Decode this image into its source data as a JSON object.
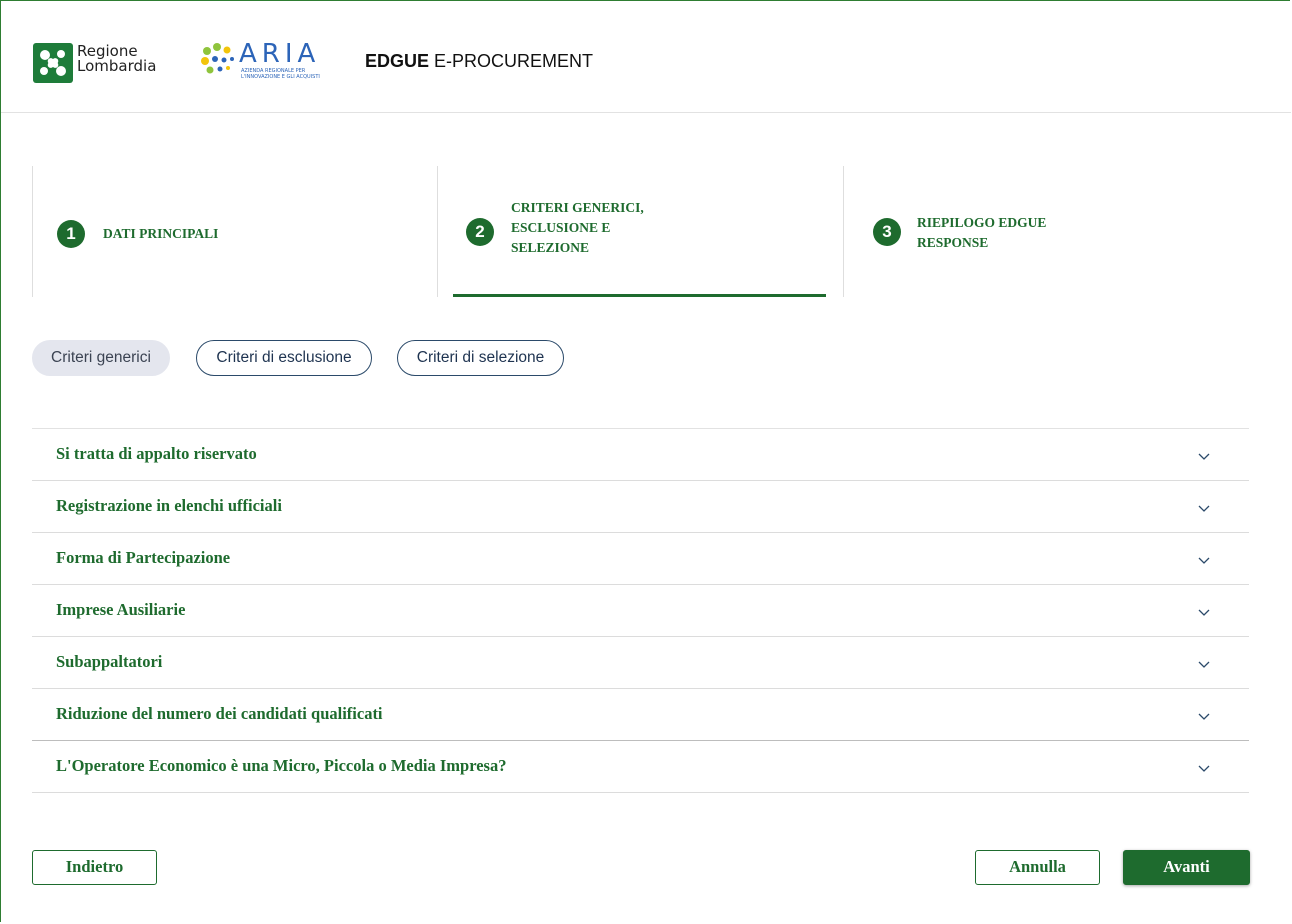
{
  "header": {
    "logo_rl_line1": "Regione",
    "logo_rl_line2": "Lombardia",
    "logo_aria_name": "ARIA",
    "logo_aria_sub1": "AZIENDA REGIONALE PER",
    "logo_aria_sub2": "L'INNOVAZIONE E GLI ACQUISTI",
    "app_title_bold": "EDGUE",
    "app_title_rest": " E-PROCUREMENT"
  },
  "stepper": {
    "steps": [
      {
        "number": "1",
        "label": "DATI PRINCIPALI"
      },
      {
        "number": "2",
        "label": "CRITERI GENERICI, ESCLUSIONE E SELEZIONE"
      },
      {
        "number": "3",
        "label": "RIEPILOGO EDGUE RESPONSE"
      }
    ],
    "active_step": 2
  },
  "tabs": [
    {
      "label": "Criteri generici",
      "active": true
    },
    {
      "label": "Criteri di esclusione",
      "active": false
    },
    {
      "label": "Criteri di selezione",
      "active": false
    }
  ],
  "accordion": {
    "items": [
      {
        "title": "Si tratta di appalto riservato"
      },
      {
        "title": "Registrazione in elenchi ufficiali"
      },
      {
        "title": "Forma di Partecipazione"
      },
      {
        "title": "Imprese Ausiliarie"
      },
      {
        "title": "Subappaltatori"
      },
      {
        "title": "Riduzione del numero dei candidati qualificati"
      },
      {
        "title": "L'Operatore Economico è una Micro, Piccola o Media Impresa?"
      }
    ],
    "chevron_icon": "chevron-down-icon"
  },
  "buttons": {
    "back": "Indietro",
    "cancel": "Annulla",
    "next": "Avanti"
  },
  "colors": {
    "primary_green": "#1e6b2e",
    "tab_border": "#2b4a6a",
    "tab_active_bg": "#e4e6ee",
    "aria_blue": "#2c64b8"
  }
}
